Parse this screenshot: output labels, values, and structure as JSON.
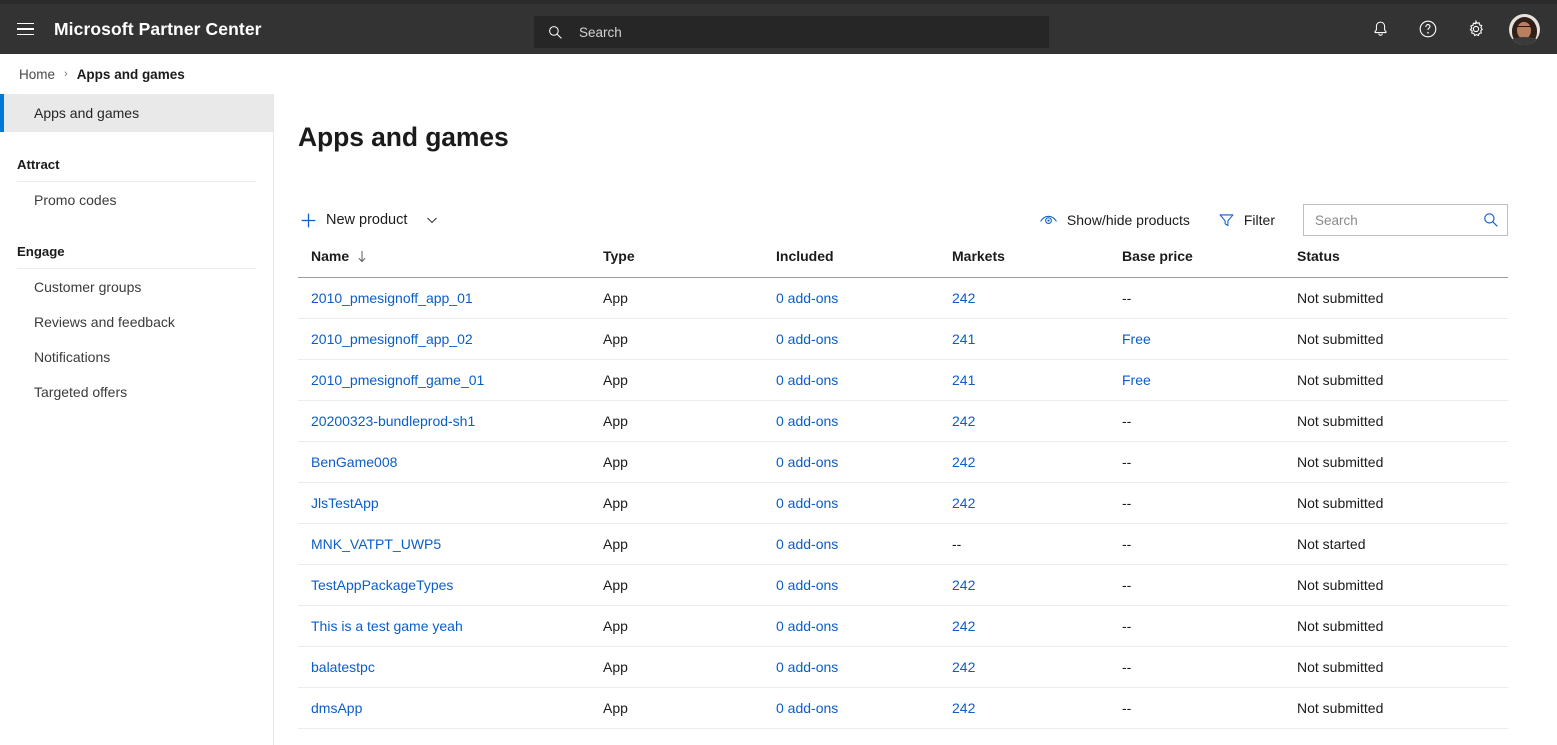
{
  "header": {
    "brand": "Microsoft Partner Center",
    "menu_icon": "hamburger-icon",
    "search_placeholder": "Search",
    "icons": [
      "notifications-bell-icon",
      "help-question-icon",
      "settings-gear-icon",
      "user-avatar"
    ]
  },
  "breadcrumb": {
    "home": "Home",
    "separator": "›",
    "current": "Apps and games"
  },
  "sidebar": {
    "selected": "Apps and games",
    "groups": [
      {
        "title": "Attract",
        "items": [
          "Promo codes"
        ]
      },
      {
        "title": "Engage",
        "items": [
          "Customer groups",
          "Reviews and feedback",
          "Notifications",
          "Targeted offers"
        ]
      }
    ]
  },
  "main": {
    "title": "Apps and games",
    "toolbar": {
      "new_product": "New product",
      "show_hide": "Show/hide products",
      "filter": "Filter",
      "search_placeholder": "Search",
      "search_value": ""
    },
    "table": {
      "columns": [
        "Name",
        "Type",
        "Included",
        "Markets",
        "Base price",
        "Status"
      ],
      "sort_column": "Name",
      "sort_direction": "asc",
      "rows": [
        {
          "name": "2010_pmesignoff_app_01",
          "type": "App",
          "included": "0 add-ons",
          "markets": "242",
          "base_price": "--",
          "status": "Not submitted"
        },
        {
          "name": "2010_pmesignoff_app_02",
          "type": "App",
          "included": "0 add-ons",
          "markets": "241",
          "base_price": "Free",
          "status": "Not submitted"
        },
        {
          "name": "2010_pmesignoff_game_01",
          "type": "App",
          "included": "0 add-ons",
          "markets": "241",
          "base_price": "Free",
          "status": "Not submitted"
        },
        {
          "name": "20200323-bundleprod-sh1",
          "type": "App",
          "included": "0 add-ons",
          "markets": "242",
          "base_price": "--",
          "status": "Not submitted"
        },
        {
          "name": "BenGame008",
          "type": "App",
          "included": "0 add-ons",
          "markets": "242",
          "base_price": "--",
          "status": "Not submitted"
        },
        {
          "name": "JlsTestApp",
          "type": "App",
          "included": "0 add-ons",
          "markets": "242",
          "base_price": "--",
          "status": "Not submitted"
        },
        {
          "name": "MNK_VATPT_UWP5",
          "type": "App",
          "included": "0 add-ons",
          "markets": "--",
          "base_price": "--",
          "status": "Not started"
        },
        {
          "name": "TestAppPackageTypes",
          "type": "App",
          "included": "0 add-ons",
          "markets": "242",
          "base_price": "--",
          "status": "Not submitted"
        },
        {
          "name": "This is a test game yeah",
          "type": "App",
          "included": "0 add-ons",
          "markets": "242",
          "base_price": "--",
          "status": "Not submitted"
        },
        {
          "name": "balatestpc",
          "type": "App",
          "included": "0 add-ons",
          "markets": "242",
          "base_price": "--",
          "status": "Not submitted"
        },
        {
          "name": "dmsApp",
          "type": "App",
          "included": "0 add-ons",
          "markets": "242",
          "base_price": "--",
          "status": "Not submitted"
        }
      ]
    }
  },
  "colors": {
    "header_bg": "#333333",
    "accent_blue": "#0078d4",
    "link_blue": "#0b5ec9",
    "selected_bg": "#e9e9e9"
  }
}
